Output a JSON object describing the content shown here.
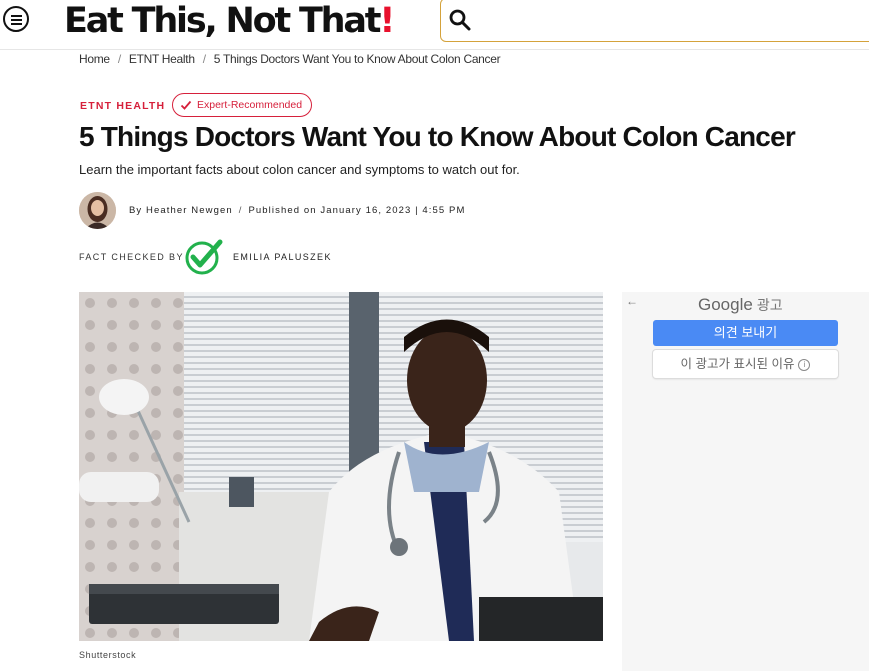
{
  "header": {
    "logo_main": "Eat This, Not That",
    "logo_bang": "!",
    "search": {
      "value": "",
      "placeholder": ""
    }
  },
  "breadcrumb": [
    "Home",
    "ETNT Health",
    "5 Things Doctors Want You to Know About Colon Cancer"
  ],
  "article": {
    "section_tag": "ETNT HEALTH",
    "badge": "Expert-Recommended",
    "title": "5 Things Doctors Want You to Know About Colon Cancer",
    "subtitle": "Learn the important facts about colon cancer and symptoms to watch out for.",
    "byline": "By Heather Newgen",
    "published": "Published on January 16, 2023 | 4:55 PM",
    "fact_checked_label": "FACT CHECKED BY",
    "fact_checker": "EMILIA PALUSZEK",
    "image_credit": "Shutterstock"
  },
  "ad": {
    "back": "←",
    "brand": "Google",
    "brand_suffix": "광고",
    "feedback_button": "의견 보내기",
    "why_button": "이 광고가 표시된 이유",
    "info_glyph": "i"
  },
  "colors": {
    "accent_red": "#d6203b",
    "search_border": "#d4a23b",
    "ad_blue": "#4a8af4",
    "check_green": "#22b14c"
  },
  "icons": [
    "menu-icon",
    "search-icon",
    "checkmark-icon",
    "fact-check-icon",
    "back-arrow-icon",
    "info-icon"
  ]
}
